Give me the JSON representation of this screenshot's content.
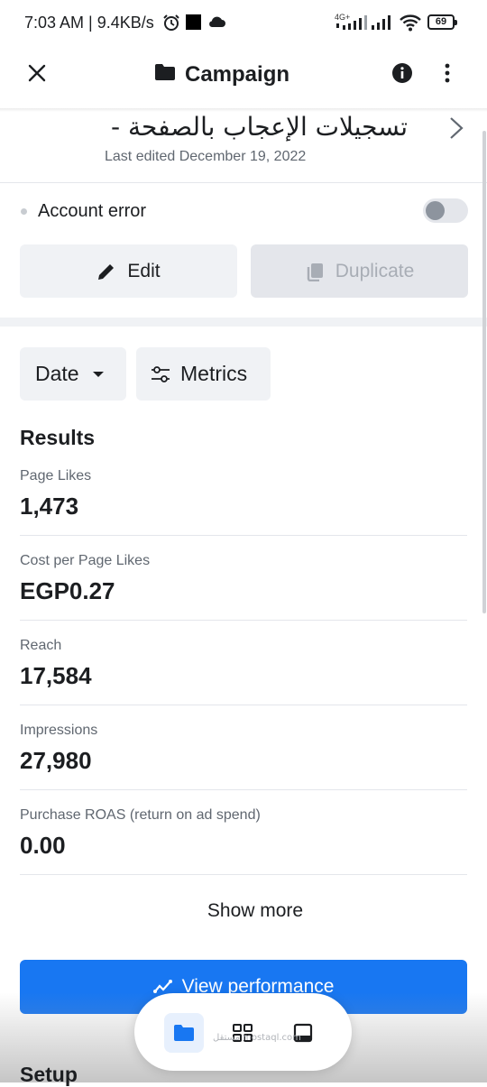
{
  "status_bar": {
    "time_and_speed": "7:03 AM | 9.4KB/s",
    "network": "4G+",
    "battery": "69"
  },
  "header": {
    "title": "Campaign"
  },
  "campaign": {
    "name": "تسجيلات الإعجاب بالصفحة -",
    "last_edited": "Last edited December 19, 2022",
    "status_text": "Account error"
  },
  "actions": {
    "edit_label": "Edit",
    "duplicate_label": "Duplicate"
  },
  "filters": {
    "date_label": "Date",
    "metrics_label": "Metrics"
  },
  "results": {
    "heading": "Results",
    "metrics": [
      {
        "label": "Page Likes",
        "value": "1,473"
      },
      {
        "label": "Cost per Page Likes",
        "value": "EGP0.27"
      },
      {
        "label": "Reach",
        "value": "17,584"
      },
      {
        "label": "Impressions",
        "value": "27,980"
      },
      {
        "label": "Purchase ROAS (return on ad spend)",
        "value": "0.00"
      }
    ],
    "show_more": "Show more"
  },
  "view_performance_label": "View performance",
  "setup_heading": "Setup",
  "watermark": "مستقل mostaql.com",
  "colors": {
    "accent": "#1877f2",
    "text": "#1c1e21",
    "secondary_text": "#606770",
    "surface": "#f0f2f5"
  }
}
